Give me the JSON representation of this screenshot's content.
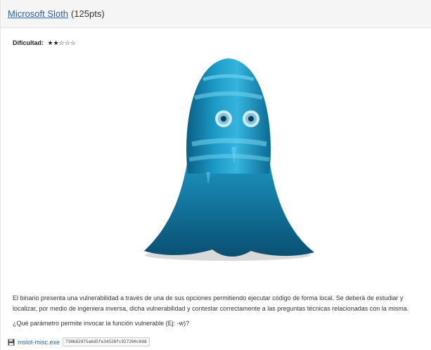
{
  "challenge": {
    "title": "Microsoft Sloth",
    "points": "(125pts)"
  },
  "difficulty": {
    "label": "Dificultad:",
    "stars": "★★☆☆☆"
  },
  "image": {
    "icon": "ghost-illustration"
  },
  "description": "El binario presenta una vulnerabilidad a través de una de sus opciones permitiendo ejecutar código de forma local. Se deberá de estudiar y localizar, por medio de ingeniera inversa, dicha vulnerabilidad y contestar correctamente a las preguntas técnicas relacionadas con la misma.",
  "question": "¿Qué parámetro permite invocar la función vulnerable (Ej: -w)?",
  "download": {
    "icon": "floppy-disk-icon",
    "filename": "mslot-misc.exe",
    "hash": "730b62975a6d5fe34328fc927290c0dd"
  }
}
